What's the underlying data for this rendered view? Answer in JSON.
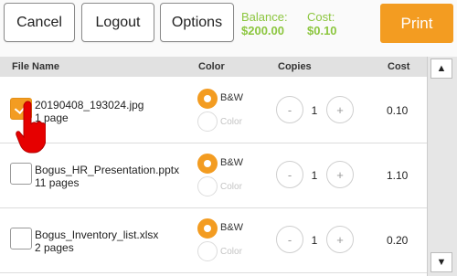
{
  "toolbar": {
    "cancel_label": "Cancel",
    "logout_label": "Logout",
    "options_label": "Options",
    "balance_label": "Balance:",
    "balance_value": "$200.00",
    "cost_label": "Cost:",
    "cost_value": "$0.10",
    "print_label": "Print"
  },
  "table": {
    "headers": {
      "file": "File Name",
      "color": "Color",
      "copies": "Copies",
      "cost": "Cost"
    },
    "rows": [
      {
        "name": "20190408_193024.jpg",
        "pages": "1 page",
        "checked": true,
        "bw_label": "B&W",
        "color_label": "Color",
        "selected_mode": "B&W",
        "copies": "1",
        "cost": "0.10"
      },
      {
        "name": "Bogus_HR_Presentation.pptx",
        "pages": "11 pages",
        "checked": false,
        "bw_label": "B&W",
        "color_label": "Color",
        "selected_mode": "B&W",
        "copies": "1",
        "cost": "1.10"
      },
      {
        "name": "Bogus_Inventory_list.xlsx",
        "pages": "2 pages",
        "checked": false,
        "bw_label": "B&W",
        "color_label": "Color",
        "selected_mode": "B&W",
        "copies": "1",
        "cost": "0.20"
      }
    ]
  },
  "stepper": {
    "minus_symbol": "-",
    "plus_symbol": "+"
  },
  "scrollbar": {
    "up_symbol": "▲",
    "down_symbol": "▼"
  },
  "colors": {
    "accent": "#f39c21",
    "money": "#8cc63f",
    "header_bg": "#e1e1e1",
    "cursor": "#e60000"
  },
  "icons": {
    "cursor": "hand-pointer-icon",
    "check": "checkmark-icon"
  }
}
